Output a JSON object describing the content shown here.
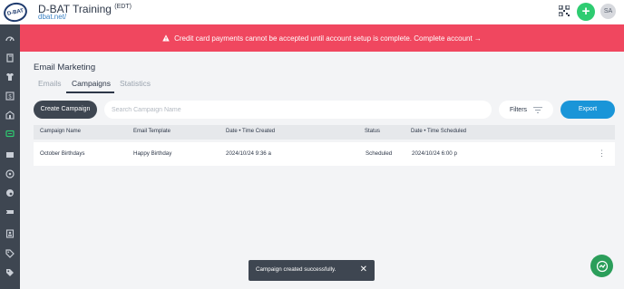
{
  "header": {
    "logo_text": "D-BAT",
    "org_name": "D-BAT Training",
    "timezone": "(EDT)",
    "org_url": "dbat.net/",
    "avatar_initials": "SA",
    "plus_label": "+"
  },
  "sidebar": {
    "icons": [
      "speedometer-icon",
      "book-icon",
      "jersey-icon",
      "dollar-icon",
      "buildings-icon",
      "chat-icon",
      "ticket-icon",
      "baseball-icon",
      "palette-icon",
      "tag-ticket-icon",
      "contacts-icon",
      "tag-icon",
      "tags-icon"
    ],
    "active_index": 5
  },
  "alert": {
    "message": "Credit card payments cannot be accepted until account setup is complete. Complete account →"
  },
  "page": {
    "title": "Email Marketing",
    "tabs": [
      {
        "label": "Emails"
      },
      {
        "label": "Campaigns"
      },
      {
        "label": "Statistics"
      }
    ],
    "active_tab": "Campaigns"
  },
  "toolbar": {
    "create_label": "Create Campaign",
    "search_placeholder": "Search Campaign Name",
    "filters_label": "Filters",
    "export_label": "Export"
  },
  "table": {
    "headers": [
      "Campaign Name",
      "Email Template",
      "Date • Time Created",
      "Status",
      "Date • Time Scheduled"
    ],
    "rows": [
      [
        "October Birthdays",
        "Happy Birthday",
        "2024/10/24 9:36 a",
        "Scheduled",
        "2024/10/24 6:00 p"
      ]
    ]
  },
  "toast": {
    "message": "Campaign created successfully.",
    "close_symbol": "✕"
  },
  "colors": {
    "alert_bg": "#f0475f",
    "sidebar_bg": "#3e4651",
    "export_bg": "#1a95d8",
    "plus_bg": "#2ecc71",
    "fab_bg": "#2b9e5a"
  }
}
